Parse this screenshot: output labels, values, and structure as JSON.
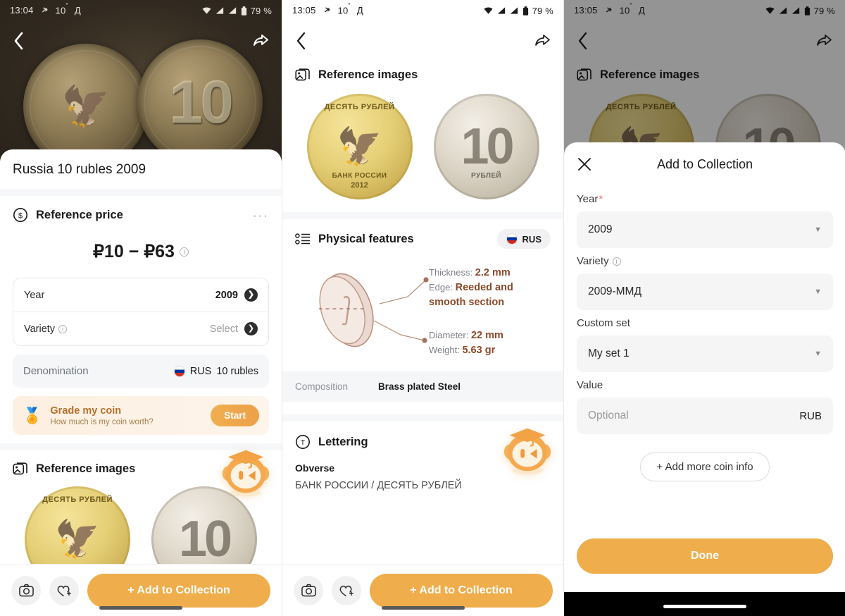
{
  "panel1": {
    "status": {
      "time": "13:04",
      "temp": "10",
      "temp_unit": "°",
      "lang": "Д",
      "battery": "79 %"
    },
    "nav": {
      "back_icon": "chevron-left-icon",
      "share_icon": "share-icon"
    },
    "coin_title": "Russia 10 rubles 2009",
    "reference_price": {
      "heading": "Reference price",
      "icon": "dollar-circle-icon",
      "menu": "···",
      "value": "₽10 − ₽63",
      "info": "i"
    },
    "rows": [
      {
        "label": "Year",
        "value": "2009",
        "muted": false
      },
      {
        "label": "Variety",
        "value": "Select",
        "muted": true,
        "info": "i"
      }
    ],
    "denomination": {
      "label": "Denomination",
      "country": "RUS",
      "value": "10 rubles"
    },
    "grade": {
      "title": "Grade my coin",
      "subtitle": "How much is my coin worth?",
      "button": "Start"
    },
    "reference_images": {
      "heading": "Reference images",
      "icon": "images-icon"
    },
    "bottom": {
      "camera_icon": "camera-icon",
      "favorite_icon": "heart-plus-icon",
      "cta": "+ Add to Collection"
    }
  },
  "panel2": {
    "status": {
      "time": "13:05",
      "temp": "10",
      "temp_unit": "°",
      "lang": "Д",
      "battery": "79 %"
    },
    "reference_images": {
      "heading": "Reference images"
    },
    "coin_obverse": {
      "top_legend": "ДЕСЯТЬ РУБЛЕЙ",
      "bottom_legend": "БАНК РОССИИ",
      "year": "2012"
    },
    "coin_reverse": {
      "value": "10",
      "legend": "РУБЛЕЙ"
    },
    "physical": {
      "heading": "Physical features",
      "badge": "RUS",
      "thickness_label": "Thickness:",
      "thickness_value": "2.2 mm",
      "edge_label": "Edge:",
      "edge_value": "Reeded and smooth section",
      "diameter_label": "Diameter:",
      "diameter_value": "22 mm",
      "weight_label": "Weight:",
      "weight_value": "5.63 gr"
    },
    "composition": {
      "label": "Composition",
      "value": "Brass plated Steel"
    },
    "lettering": {
      "heading": "Lettering",
      "icon": "text-circle-icon",
      "obverse_label": "Obverse",
      "obverse_value": "БАНК РОССИИ / ДЕСЯТЬ РУБЛЕЙ"
    },
    "bottom": {
      "cta": "+ Add to Collection"
    }
  },
  "panel3": {
    "status": {
      "time": "13:05",
      "temp": "10",
      "temp_unit": "°",
      "lang": "Д",
      "battery": "79 %"
    },
    "reference_images": {
      "heading": "Reference images"
    },
    "modal": {
      "title": "Add to Collection",
      "close_icon": "close-icon",
      "year_label": "Year",
      "year_required": "*",
      "year_value": "2009",
      "variety_label": "Variety",
      "variety_value": "2009-ММД",
      "custom_set_label": "Custom set",
      "custom_set_value": "My set 1",
      "value_label": "Value",
      "value_placeholder": "Optional",
      "value_currency": "RUB",
      "add_more": "+ Add more coin info",
      "done": "Done"
    }
  },
  "colors": {
    "accent": "#efad4b",
    "brown": "#8b4a2b",
    "required": "#e8707a",
    "grade_title": "#b4702a"
  }
}
